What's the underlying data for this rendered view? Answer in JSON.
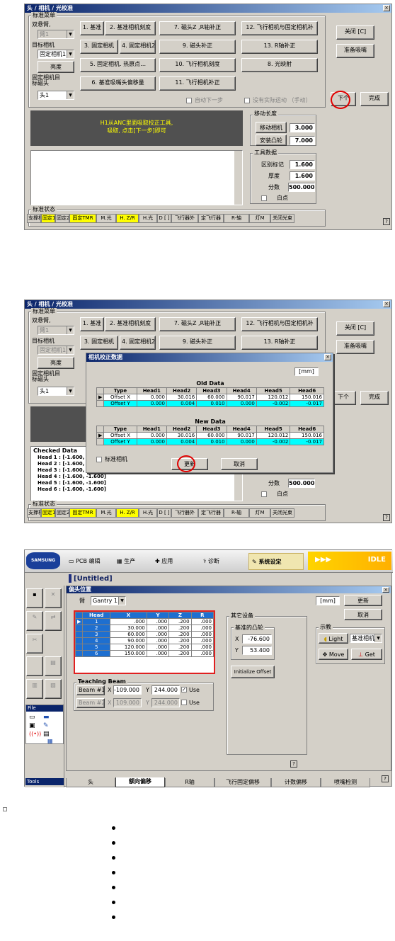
{
  "screen1": {
    "title": "头 / 相机 / 光校准",
    "menu_group": "标准菜单",
    "arm_label": "双悬臂,",
    "arm_value": "臂1",
    "target_camera_label": "目标相机",
    "target_camera_value": "固定相机1",
    "brightness_btn": "亮度",
    "fixed_camera_target_label": "固定相机目\n标磁头",
    "head_value": "头1",
    "buttons": [
      "1. 基准",
      "2. 基准相机刻度",
      "7. 磁头Z ,R轴补正",
      "12. 飞行相机与固定相机补",
      "3. 固定相机",
      "4. 固定相机2",
      "9. 磁头补正",
      "13. R轴补正",
      "5. 固定相机. 热原点…",
      "10. 飞行相机刻度",
      "8. 光映射",
      "6. 基准吸嘴头偏移量",
      "11. 飞行相机补正"
    ],
    "close_btn": "关闭 [C]",
    "prepare_btn": "准备吸嘴",
    "auto_next": "自动下一步",
    "no_actual_move": "没有实际运动 （手动）",
    "next_btn": "下个",
    "finish_btn": "完成",
    "message": "H1从ANC里面吸取校正工具,\n吸取, 点击[下一步]即可",
    "move_group": "移动长度",
    "move_camera_label": "移动相机",
    "move_camera_value": "3.000",
    "install_cam_label": "安装凸轮",
    "install_cam_value": "7.000",
    "tool_group": "工具数据",
    "region_mark_label": "区别标记",
    "region_mark_value": "1.600",
    "thickness_label": "厚度",
    "thickness_value": "1.600",
    "score_label": "分数",
    "score_value": "500.000",
    "white_point": "白点",
    "status_group": "标准状态",
    "status_items": [
      "支撑相",
      "固定1",
      "固定2",
      "固定TMR",
      "M.光",
      "H. Z/R",
      "H.光",
      "D [ ]",
      "飞行器外",
      "定飞行器",
      "R-轴",
      "灯M",
      "关闭光束"
    ],
    "help": "?"
  },
  "screen2": {
    "title": "头 / 相机 / 光校准",
    "menu_group": "标准菜单",
    "arm_label": "双悬臂,",
    "arm_value": "臂1",
    "target_camera_label": "目标相机",
    "target_camera_value": "固定相机1",
    "brightness_btn": "亮度",
    "fixed_camera_target_label": "固定相机目\n标磁头",
    "head_value": "头1",
    "buttons_row1": [
      "1. 基准",
      "2. 基准相机刻度",
      "7. 磁头Z ,R轴补正",
      "12. 飞行相机与固定相机补"
    ],
    "buttons_row2": [
      "3. 固定相机",
      "4. 固定相机2",
      "9. 磁头补正",
      "13. R轴补正"
    ],
    "close_btn": "关闭 [C]",
    "prepare_btn": "准备吸嘴",
    "next_btn": "下个",
    "finish_btn": "完成",
    "checked_data_title": "Checked Data",
    "checked_lines": [
      "Head 1 : [-1.600, -1.600]",
      "Head 2 : [-1.600, -1.600]",
      "Head 3 : [-1.600, -1.600]",
      "Head 4 : [-1.600, -1.600]",
      "Head 5 : [-1.600, -1.600]",
      "Head 6 : [-1.600, -1.600]"
    ],
    "score_label": "分数",
    "score_value": "500.000",
    "white_point": "白点",
    "status_group": "标准状态",
    "status_items": [
      "支撑相",
      "固定1",
      "固定2",
      "固定TMR",
      "M.光",
      "H. Z/R",
      "H.光",
      "D [ ]",
      "飞行器外",
      "定飞行器",
      "R-轴",
      "灯M",
      "关闭光束"
    ],
    "dialog": {
      "title": "相机校正数据",
      "unit": "[mm]",
      "old_title": "Old Data",
      "new_title": "New Data",
      "columns": [
        "Type",
        "Head1",
        "Head2",
        "Head3",
        "Head4",
        "Head5",
        "Head6"
      ],
      "old_rows": [
        [
          "Offset X",
          "0.000",
          "30.016",
          "60.000",
          "90.017",
          "120.012",
          "150.016"
        ],
        [
          "Offset Y",
          "0.000",
          "0.004",
          "0.010",
          "0.000",
          "-0.002",
          "-0.017"
        ]
      ],
      "new_rows": [
        [
          "Offset X",
          "0.000",
          "30.016",
          "60.000",
          "90.017",
          "120.012",
          "150.016"
        ],
        [
          "Offset Y",
          "0.000",
          "0.004",
          "0.010",
          "0.000",
          "-0.002",
          "-0.017"
        ]
      ],
      "std_camera": "标准相机",
      "update_btn": "更新",
      "cancel_btn": "取消"
    },
    "help": "?"
  },
  "screen3": {
    "brand": "SAMSUNG",
    "nav": [
      "PCB 编辑",
      "生产",
      "应用",
      "诊断",
      "系统设定"
    ],
    "status": "IDLE",
    "doc_title": "[Untitled]",
    "panel_title": "偏头位置",
    "arm_label": "臂",
    "gantry_value": "Gantry 1",
    "unit": "[mm]",
    "update_btn": "更新",
    "cancel_btn": "取消",
    "table_columns": [
      "Head",
      "X",
      "Y",
      "Z",
      "R"
    ],
    "table_rows": [
      [
        "1",
        ".000",
        ".000",
        ".200",
        ".000"
      ],
      [
        "2",
        "30.000",
        ".000",
        ".200",
        ".000"
      ],
      [
        "3",
        "60.000",
        ".000",
        ".200",
        ".000"
      ],
      [
        "4",
        "90.000",
        ".000",
        ".200",
        ".000"
      ],
      [
        "5",
        "120.000",
        ".000",
        ".200",
        ".000"
      ],
      [
        "6",
        "150.000",
        ".000",
        ".200",
        ".000"
      ]
    ],
    "other_equipment": "其它设备",
    "ref_cam": "基准的凸轮",
    "ref_x_label": "X",
    "ref_x_value": "-76.600",
    "ref_y_label": "Y",
    "ref_y_value": "53.400",
    "init_offset_btn": "Initialize Offset",
    "teach_title": "Teaching Beam",
    "beam1": "Beam #1",
    "beam1_x_label": "X",
    "beam1_x": "-109.000",
    "beam1_y_label": "Y",
    "beam1_y": "244.000",
    "beam1_use": "Use",
    "beam2": "Beam #2",
    "beam2_x_label": "X",
    "beam2_x": "109.000",
    "beam2_y_label": "Y",
    "beam2_y": "244.000",
    "beam2_use": "Use",
    "teach_group": "示教",
    "light_btn": "Light",
    "camera_select": "基准相机1",
    "move_btn": "Move",
    "get_btn": "Get",
    "tabs": [
      "头",
      "额向偏移",
      "R轴",
      "飞行固定偏移",
      "计数偏移",
      "喷嘴检测"
    ],
    "file_label": "File",
    "tools_label": "Tools",
    "help": "?"
  }
}
